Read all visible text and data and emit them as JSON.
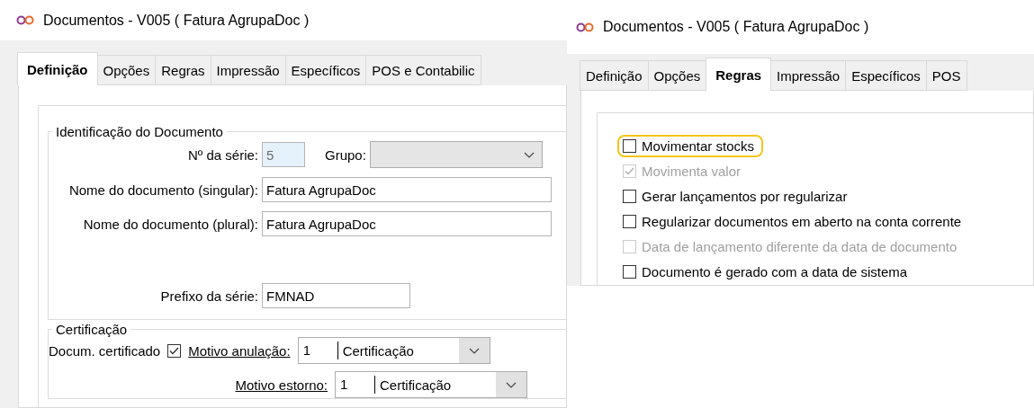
{
  "definition_window": {
    "title": "Documentos - V005 ( Fatura AgrupaDoc )",
    "tabs": [
      {
        "label": "Definição",
        "selected": true
      },
      {
        "label": "Opções",
        "selected": false
      },
      {
        "label": "Regras",
        "selected": false
      },
      {
        "label": "Impressão",
        "selected": false
      },
      {
        "label": "Específicos",
        "selected": false
      },
      {
        "label": "POS e Contabilic",
        "selected": false
      }
    ],
    "identification": {
      "legend": "Identificação do Documento",
      "series_number": {
        "label": "Nº da série:",
        "value": "5",
        "disabled": true
      },
      "group": {
        "label": "Grupo:",
        "disabled": true
      },
      "name_singular": {
        "label": "Nome do documento (singular):",
        "value": "Fatura AgrupaDoc"
      },
      "name_plural": {
        "label": "Nome do documento (plural):",
        "value": "Fatura AgrupaDoc"
      },
      "series_prefix": {
        "label": "Prefixo da série:",
        "value": "FMNAD"
      }
    },
    "certification": {
      "legend": "Certificação",
      "certified": {
        "label": "Docum. certificado",
        "checked": true
      },
      "cancellation_reason": {
        "label": "Motivo anulação:",
        "code": "1",
        "description": "Certificação"
      },
      "reversal_reason": {
        "label": "Motivo estorno:",
        "code": "1",
        "description": "Certificação"
      }
    }
  },
  "rules_window": {
    "title": "Documentos - V005 ( Fatura AgrupaDoc )",
    "tabs": [
      {
        "label": "Definição",
        "selected": false
      },
      {
        "label": "Opções",
        "selected": false
      },
      {
        "label": "Regras",
        "selected": true
      },
      {
        "label": "Impressão",
        "selected": false
      },
      {
        "label": "Específicos",
        "selected": false
      },
      {
        "label": "POS",
        "selected": false
      }
    ],
    "options": [
      {
        "label": "Movimentar stocks",
        "checked": false,
        "disabled": false,
        "highlighted": true
      },
      {
        "label": "Movimenta valor",
        "checked": true,
        "disabled": true,
        "highlighted": false
      },
      {
        "label": "Gerar lançamentos por regularizar",
        "checked": false,
        "disabled": false,
        "highlighted": false
      },
      {
        "label": "Regularizar documentos em aberto na conta corrente",
        "checked": false,
        "disabled": false,
        "highlighted": false
      },
      {
        "label": "Data de lançamento diferente da data de documento",
        "checked": false,
        "disabled": true,
        "highlighted": false
      },
      {
        "label": "Documento é gerado com a data de sistema",
        "checked": false,
        "disabled": false,
        "highlighted": false
      }
    ]
  }
}
